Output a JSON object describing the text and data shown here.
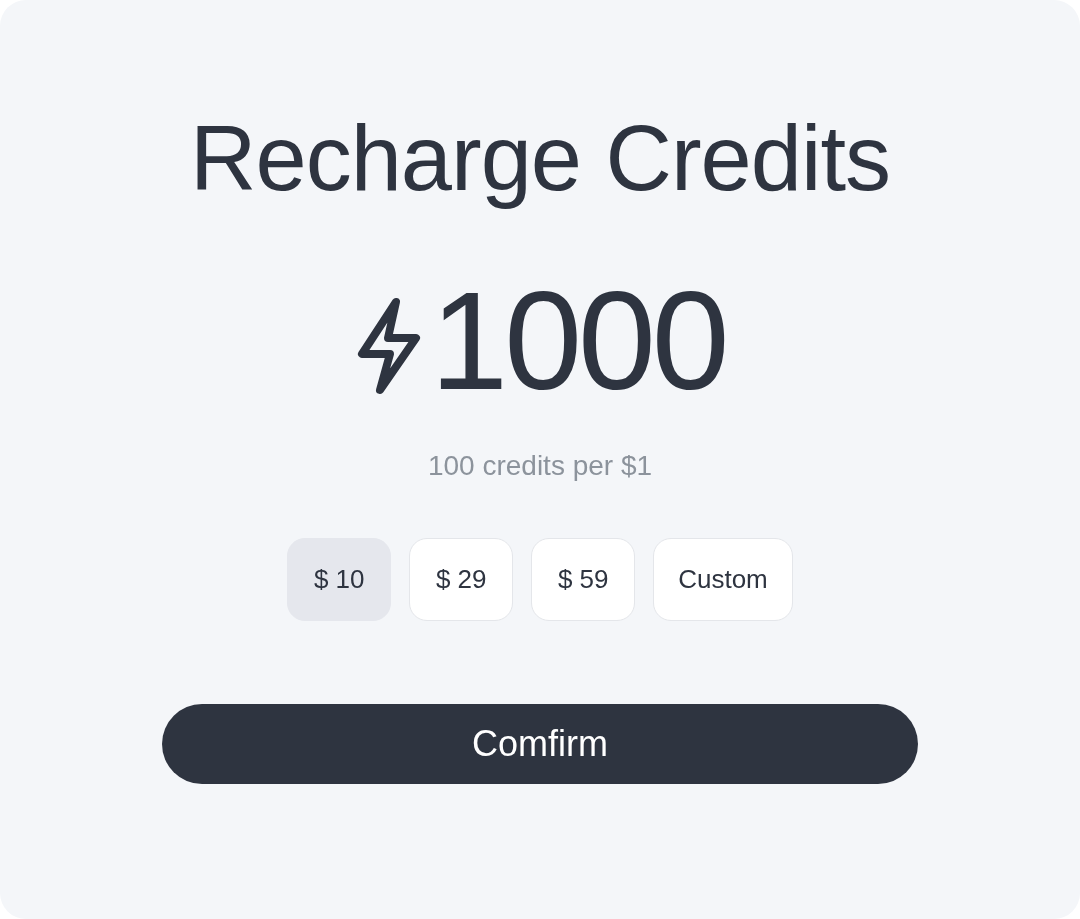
{
  "title": "Recharge Credits",
  "amount": "1000",
  "rate": "100 credits per $1",
  "options": [
    {
      "label": "$ 10",
      "selected": true
    },
    {
      "label": "$ 29",
      "selected": false
    },
    {
      "label": "$ 59",
      "selected": false
    },
    {
      "label": "Custom",
      "selected": false
    }
  ],
  "confirm": "Comfirm"
}
